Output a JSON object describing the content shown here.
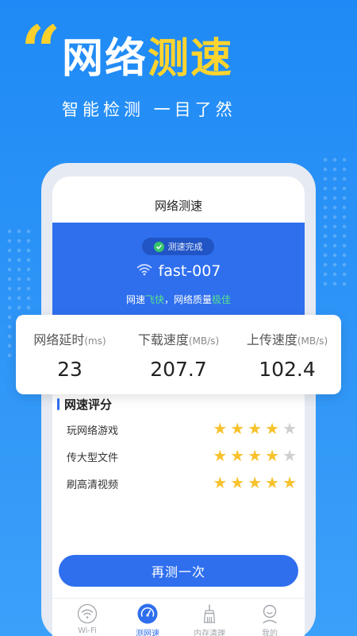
{
  "hero": {
    "quote": "“",
    "title_part1": "网络",
    "title_part2": "测速",
    "subtitle": "智能检测 一目了然"
  },
  "screen": {
    "title": "网络测速",
    "status": "测速完成",
    "wifi_name": "fast-007",
    "quality_prefix": "网速",
    "quality_speed": "飞快",
    "quality_middle": "，网络质量",
    "quality_level": "极佳"
  },
  "stats": [
    {
      "label": "网络延时",
      "unit": "(ms)",
      "value": "23"
    },
    {
      "label": "下载速度",
      "unit": "(MB/s)",
      "value": "207.7"
    },
    {
      "label": "上传速度",
      "unit": "(MB/s)",
      "value": "102.4"
    }
  ],
  "rating": {
    "title": "网速评分",
    "items": [
      {
        "label": "玩网络游戏",
        "stars": 4,
        "max": 5
      },
      {
        "label": "传大型文件",
        "stars": 4,
        "max": 5
      },
      {
        "label": "刷高清视频",
        "stars": 5,
        "max": 5
      }
    ]
  },
  "retest_label": "再测一次",
  "tabs": [
    {
      "label": "Wi-Fi",
      "icon": "wifi-icon",
      "active": false
    },
    {
      "label": "测网速",
      "icon": "speedometer-icon",
      "active": true
    },
    {
      "label": "内存清理",
      "icon": "broom-icon",
      "active": false
    },
    {
      "label": "我的",
      "icon": "user-icon",
      "active": false
    }
  ],
  "colors": {
    "background": "#1f8af5",
    "accent": "#2f6fee",
    "highlight": "#ffd42e",
    "good": "#58e28a",
    "star": "#f7c22c"
  }
}
